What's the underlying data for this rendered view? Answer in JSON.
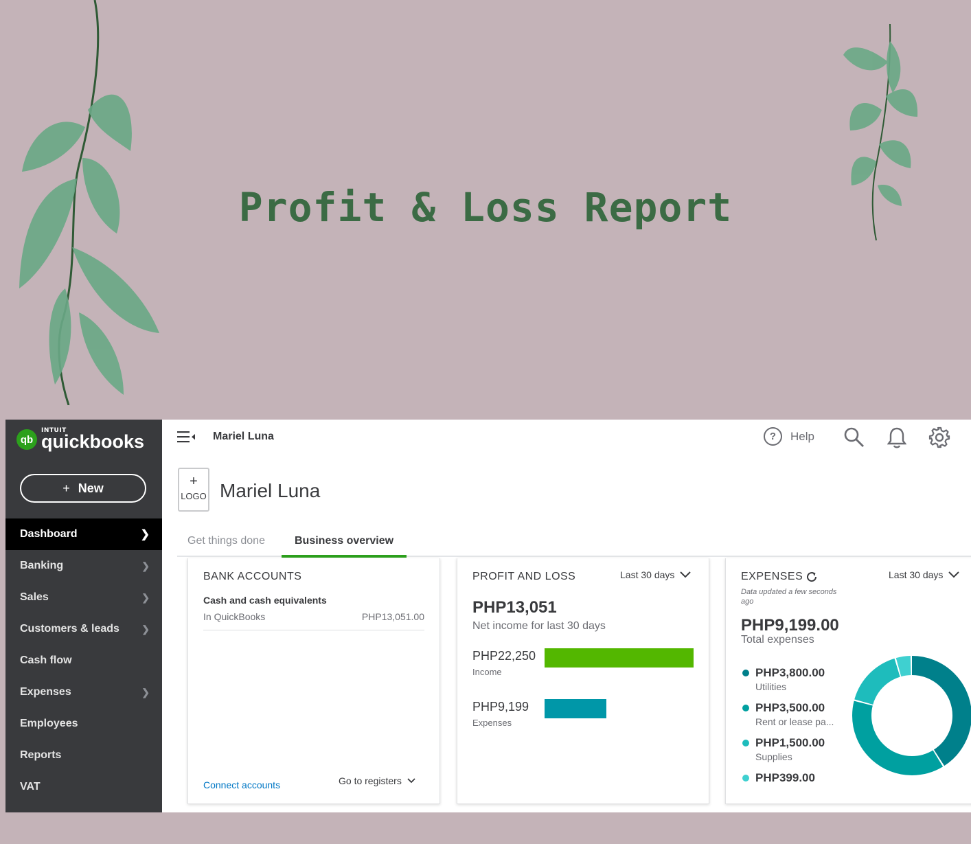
{
  "header": {
    "title": "Profit & Loss Report"
  },
  "app": {
    "brand_intuit": "INTUIT",
    "brand_name": "quickbooks",
    "brand_logo": "qb",
    "new_button": "New",
    "nav": [
      {
        "label": "Dashboard",
        "active": true,
        "chevron": true
      },
      {
        "label": "Banking",
        "chevron": true
      },
      {
        "label": "Sales",
        "chevron": true
      },
      {
        "label": "Customers & leads",
        "chevron": true
      },
      {
        "label": "Cash flow",
        "chevron": false
      },
      {
        "label": "Expenses",
        "chevron": true
      },
      {
        "label": "Employees",
        "chevron": false
      },
      {
        "label": "Reports",
        "chevron": false
      },
      {
        "label": "VAT",
        "chevron": false
      }
    ],
    "topbar": {
      "company": "Mariel Luna",
      "help": "Help",
      "help_icon": "?"
    },
    "logo_box": {
      "plus": "+",
      "label": "LOGO"
    },
    "company_name": "Mariel Luna",
    "tabs": [
      "Get things done",
      "Business overview"
    ],
    "bank": {
      "title": "BANK ACCOUNTS",
      "subtitle": "Cash and cash equivalents",
      "row_label": "In QuickBooks",
      "row_value": "PHP13,051.00",
      "connect": "Connect accounts",
      "goto": "Go to registers"
    },
    "pnl": {
      "title": "PROFIT AND LOSS",
      "range": "Last 30 days",
      "net": "PHP13,051",
      "net_caption": "Net income for last 30 days",
      "income_amount": "PHP22,250",
      "income_label": "Income",
      "income_value": 22250,
      "expense_amount": "PHP9,199",
      "expense_label": "Expenses",
      "expense_value": 9199,
      "income_color": "#53b700",
      "expense_color": "#0097a8"
    },
    "expenses": {
      "title": "EXPENSES",
      "range": "Last 30 days",
      "updated": "Data updated a few seconds ago",
      "total": "PHP9,199.00",
      "total_caption": "Total expenses",
      "items": [
        {
          "amount": "PHP3,800.00",
          "name": "Utilities",
          "value": 3800,
          "color": "#00808b"
        },
        {
          "amount": "PHP3,500.00",
          "name": "Rent or lease pa...",
          "value": 3500,
          "color": "#00a0a0"
        },
        {
          "amount": "PHP1,500.00",
          "name": "Supplies",
          "value": 1500,
          "color": "#1ebcbc"
        },
        {
          "amount": "PHP399.00",
          "name": "",
          "value": 399,
          "color": "#3fd0d0"
        }
      ]
    }
  }
}
